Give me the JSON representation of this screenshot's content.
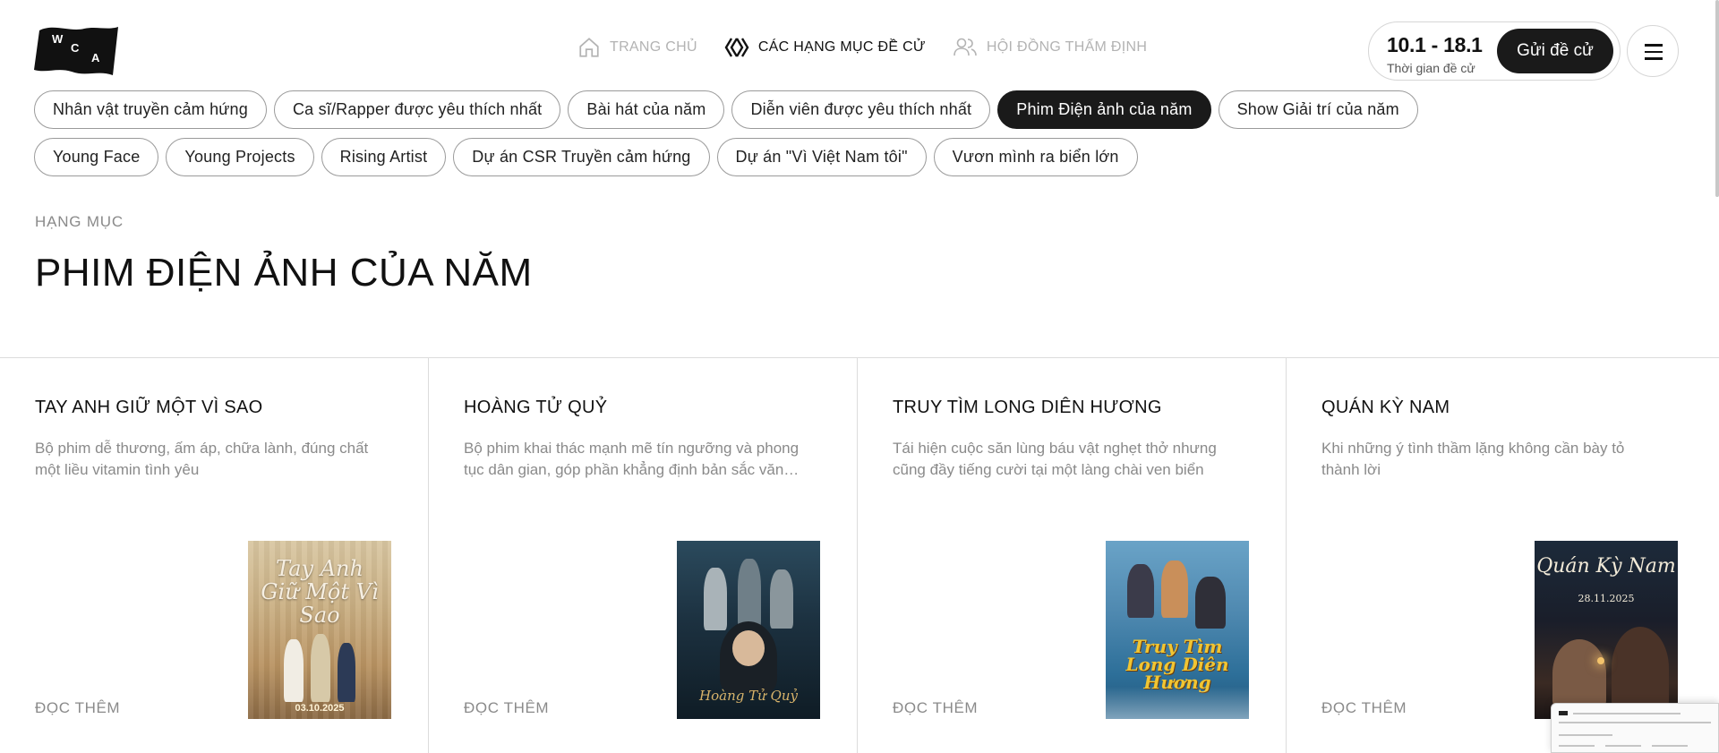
{
  "header": {
    "logo_letters": [
      "W",
      "C",
      "A"
    ],
    "nav": [
      {
        "label": "TRANG CHỦ",
        "icon": "home-icon",
        "active": false
      },
      {
        "label": "CÁC HẠNG MỤC ĐỀ CỬ",
        "icon": "chevrons-icon",
        "active": true
      },
      {
        "label": "HỘI ĐỒNG THẨM ĐỊNH",
        "icon": "users-icon",
        "active": false
      }
    ],
    "period_dates": "10.1 - 18.1",
    "period_label": "Thời gian đề cử",
    "submit_label": "Gửi đề cử",
    "menu_icon": "hamburger-icon"
  },
  "categories": {
    "row1": [
      "Nhân vật truyền cảm hứng",
      "Ca sĩ/Rapper được yêu thích nhất",
      "Bài hát của năm",
      "Diễn viên được yêu thích nhất",
      "Phim Điện ảnh của năm",
      "Show Giải trí của năm"
    ],
    "row2": [
      "Young Face",
      "Young Projects",
      "Rising Artist",
      "Dự án CSR Truyền cảm hứng",
      "Dự án \"Vì Việt Nam tôi\"",
      "Vươn mình ra biển lớn"
    ],
    "active": "Phim Điện ảnh của năm"
  },
  "section": {
    "kicker": "HẠNG MỤC",
    "title": "PHIM ĐIỆN ẢNH CỦA NĂM"
  },
  "cards": [
    {
      "title": "TAY ANH GIỮ MỘT VÌ SAO",
      "desc": "Bộ phim dễ thương, ấm áp, chữa lành, đúng chất một liều vitamin tình yêu",
      "more": "ĐỌC THÊM",
      "poster_title": "Tay Anh Giữ Một Vì Sao",
      "poster_date": "03.10.2025"
    },
    {
      "title": "HOÀNG TỬ QUỶ",
      "desc": "Bộ phim khai thác mạnh mẽ tín ngưỡng và phong tục dân gian, góp phần khẳng định bản sắc văn hoá Việt",
      "more": "ĐỌC THÊM",
      "poster_title": "Hoàng Tử Quỷ",
      "poster_date": ""
    },
    {
      "title": "TRUY TÌM LONG DIÊN HƯƠNG",
      "desc": "Tái hiện cuộc săn lùng báu vật nghẹt thở nhưng cũng đầy tiếng cười tại một làng chài ven biển",
      "more": "ĐỌC THÊM",
      "poster_title": "Truy Tìm Long Diên Hương",
      "poster_date": ""
    },
    {
      "title": "QUÁN KỲ NAM",
      "desc": "Khi những ý tình thầm lặng không cần bày tỏ thành lời",
      "more": "ĐỌC THÊM",
      "poster_title": "Quán Kỳ Nam",
      "poster_date": "28.11.2025"
    }
  ],
  "colors": {
    "accent": "#1a1a1a",
    "muted": "#8a8a8a",
    "border": "#dcdcdc"
  }
}
